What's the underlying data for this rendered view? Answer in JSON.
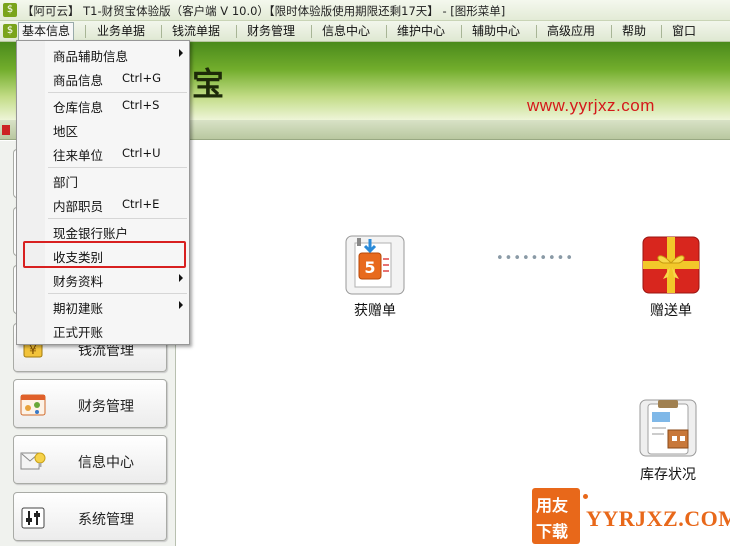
{
  "window": {
    "title": "【阿可云】 T1-财贸宝体验版（客户端 V 10.0）【限时体验版使用期限还剩17天】 - [图形菜单]"
  },
  "menubar": {
    "items": [
      {
        "label": "基本信息",
        "active": true
      },
      {
        "label": "业务单据"
      },
      {
        "label": "钱流单据"
      },
      {
        "label": "财务管理"
      },
      {
        "label": "信息中心"
      },
      {
        "label": "维护中心"
      },
      {
        "label": "辅助中心"
      },
      {
        "label": "高级应用"
      },
      {
        "label": "帮助"
      },
      {
        "label": "窗口"
      }
    ]
  },
  "banner": {
    "brand_char": "宝",
    "site_url": "www.yyrjxz.com"
  },
  "dropdown": {
    "items": [
      {
        "label": "商品辅助信息",
        "shortcut": "",
        "submenu": true
      },
      {
        "label": "商品信息",
        "shortcut": "Ctrl+G"
      },
      {
        "label": "仓库信息",
        "shortcut": "Ctrl+S"
      },
      {
        "label": "地区",
        "shortcut": ""
      },
      {
        "label": "往来单位",
        "shortcut": "Ctrl+U"
      },
      {
        "label": "部门",
        "shortcut": ""
      },
      {
        "label": "内部职员",
        "shortcut": "Ctrl+E"
      },
      {
        "label": "现金银行账户",
        "shortcut": ""
      },
      {
        "label": "收支类别",
        "shortcut": "",
        "highlighted": true
      },
      {
        "label": "财务资料",
        "shortcut": "",
        "submenu": true
      },
      {
        "label": "期初建账",
        "shortcut": "",
        "submenu": true
      },
      {
        "label": "正式开账",
        "shortcut": ""
      }
    ]
  },
  "leftnav": {
    "items": [
      {
        "label": "钱流管理",
        "icon": "money-flow-icon"
      },
      {
        "label": "财务管理",
        "icon": "finance-icon"
      },
      {
        "label": "信息中心",
        "icon": "info-center-icon"
      },
      {
        "label": "系统管理",
        "icon": "system-settings-icon"
      }
    ]
  },
  "desktop": {
    "icons": [
      {
        "label": "获赠单",
        "icon": "received-gift-doc-icon"
      },
      {
        "label": "赠送单",
        "icon": "gift-box-icon"
      },
      {
        "label": "库存状况",
        "icon": "inventory-clipboard-icon"
      }
    ]
  },
  "watermark": {
    "line1": "用友",
    "line2": "下载",
    "text": "YYRJXZ.COM"
  },
  "colors": {
    "highlight": "#d82020",
    "banner_green": "#72ad2c",
    "url_red": "#d4181a",
    "watermark_orange": "#e8681a"
  }
}
